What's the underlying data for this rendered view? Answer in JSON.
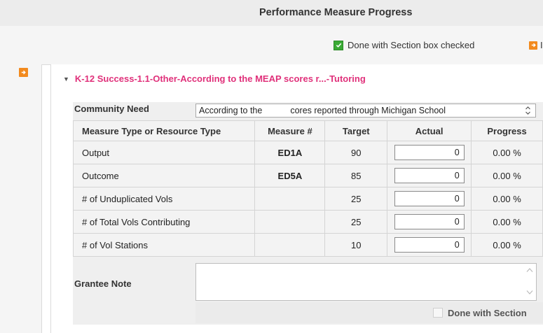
{
  "header": {
    "title": "Performance Measure Progress"
  },
  "legend": {
    "done_checked_label": "Done with Section box checked",
    "cut_label": "I"
  },
  "section": {
    "title": "K-12 Success-1.1-Other-According to the MEAP scores r...-Tutoring"
  },
  "community_need": {
    "label": "Community Need",
    "value_before": "According to the",
    "value_after": "cores reported through Michigan School"
  },
  "table": {
    "headers": [
      "Measure Type or Resource Type",
      "Measure #",
      "Target",
      "Actual",
      "Progress"
    ],
    "rows": [
      {
        "type": "Output",
        "measure": "ED1A",
        "target": "90",
        "actual": "0",
        "progress": "0.00 %"
      },
      {
        "type": "Outcome",
        "measure": "ED5A",
        "target": "85",
        "actual": "0",
        "progress": "0.00 %"
      },
      {
        "type": "# of Unduplicated Vols",
        "measure": "",
        "target": "25",
        "actual": "0",
        "progress": "0.00 %"
      },
      {
        "type": "# of Total Vols Contributing",
        "measure": "",
        "target": "25",
        "actual": "0",
        "progress": "0.00 %"
      },
      {
        "type": "# of Vol Stations",
        "measure": "",
        "target": "10",
        "actual": "0",
        "progress": "0.00 %"
      }
    ]
  },
  "grantee_note": {
    "label": "Grantee Note",
    "value": ""
  },
  "done_section": {
    "label": "Done with Section",
    "checked": false
  },
  "colors": {
    "accent_pink": "#e0307a",
    "check_green": "#3aaa35",
    "arrow_orange": "#f28a1e"
  }
}
